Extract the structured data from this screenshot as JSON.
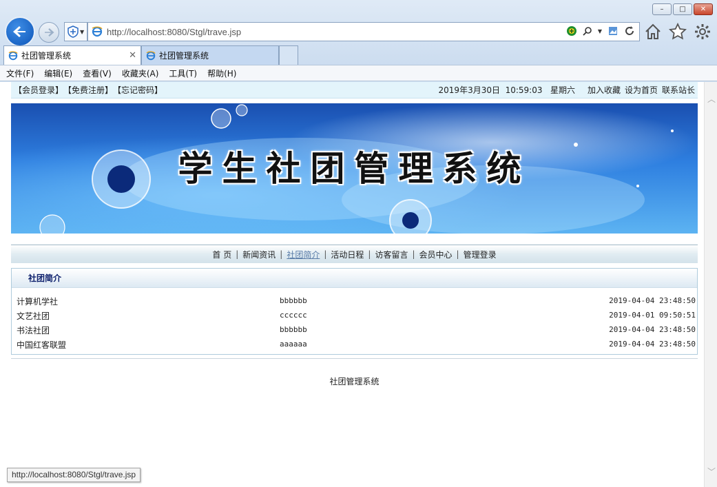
{
  "browser": {
    "url": "http://localhost:8080/Stgl/trave.jsp",
    "tabs": [
      {
        "label": "社团管理系统",
        "active": true
      },
      {
        "label": "社团管理系统",
        "active": false
      }
    ],
    "menu": [
      "文件(F)",
      "编辑(E)",
      "查看(V)",
      "收藏夹(A)",
      "工具(T)",
      "帮助(H)"
    ],
    "window_controls": {
      "minimize": "–",
      "maximize": "□",
      "close": "✕"
    },
    "status_url": "http://localhost:8080/Stgl/trave.jsp"
  },
  "site": {
    "top_links": [
      "【会员登录】",
      "【免费注册】",
      "【忘记密码】"
    ],
    "clock": "2019年3月30日  10:59:03   星期六",
    "top_right_links": [
      "加入收藏",
      "设为首页",
      "联系站长"
    ],
    "banner_title": "学生社团管理系统",
    "nav": [
      {
        "label": "首 页",
        "current": false
      },
      {
        "label": "新闻资讯",
        "current": false
      },
      {
        "label": "社团简介",
        "current": true
      },
      {
        "label": "活动日程",
        "current": false
      },
      {
        "label": "访客留言",
        "current": false
      },
      {
        "label": "会员中心",
        "current": false
      },
      {
        "label": "管理登录",
        "current": false
      }
    ],
    "panel_title": "社团简介",
    "clubs": [
      {
        "name": "计算机学社",
        "desc": "bbbbbb",
        "time": "2019-04-04 23:48:50"
      },
      {
        "name": "文艺社团",
        "desc": "cccccc",
        "time": "2019-04-01 09:50:51"
      },
      {
        "name": "书法社团",
        "desc": "bbbbbb",
        "time": "2019-04-04 23:48:50"
      },
      {
        "name": "中国红客联盟",
        "desc": "aaaaaa",
        "time": "2019-04-04 23:48:50"
      }
    ],
    "footer": "社团管理系统"
  },
  "colors": {
    "accent": "#0d55b8",
    "panel_title": "#0b1e6b",
    "topbar_bg": "#e3f4fb"
  }
}
